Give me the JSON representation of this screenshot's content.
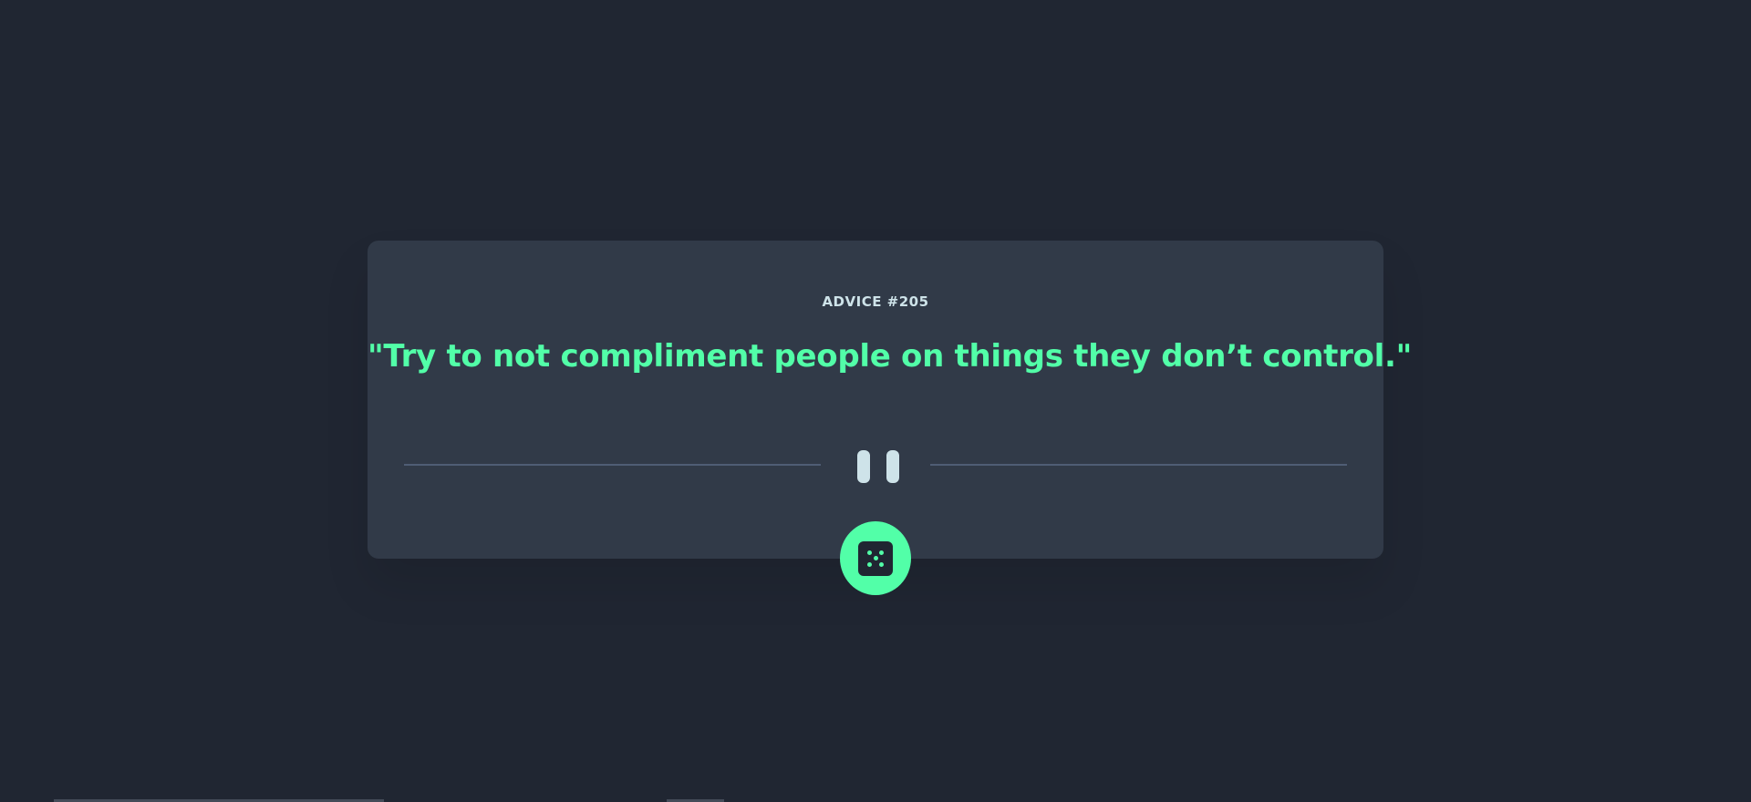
{
  "advice": {
    "heading": "ADVICE #205",
    "quote": "\"Try to not compliment people on things they don’t control.\""
  },
  "divider": {
    "icon": "pause-icon"
  },
  "actions": {
    "new_advice_icon": "dice-icon"
  },
  "colors": {
    "background": "#202632",
    "card": "#313a48",
    "accent": "#52ffa8",
    "heading_text": "#cee3e9",
    "divider": "#4f5d74"
  }
}
